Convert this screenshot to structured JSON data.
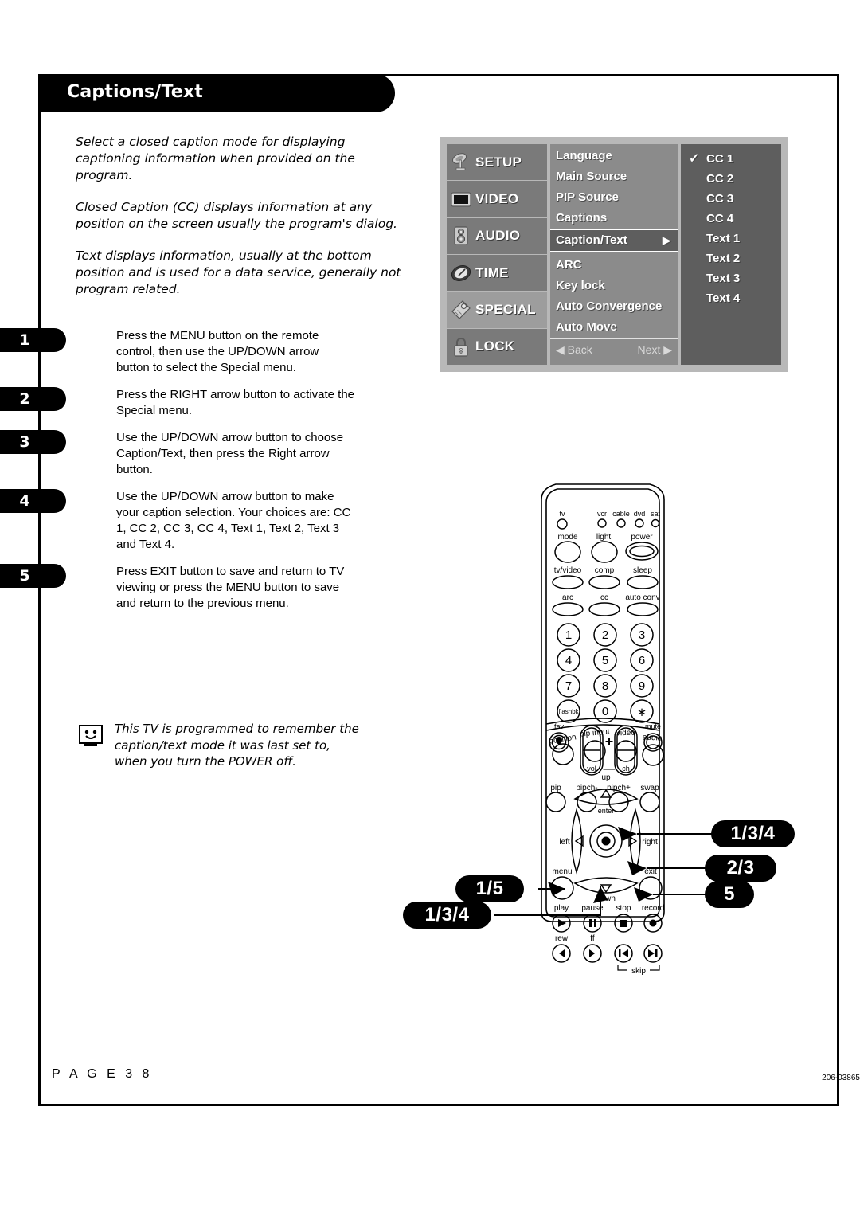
{
  "header": {
    "title": "Captions/Text"
  },
  "intro": {
    "paragraphs": [
      "Select a closed caption mode for displaying captioning information when provided on the program.",
      "Closed Caption (CC) displays information at any position on the screen usually the program's dialog.",
      "Text displays information, usually at the bottom position and is used for a data service, generally not program related."
    ]
  },
  "osd": {
    "categories": [
      {
        "label": "SETUP",
        "icon": "satellite-dish-icon",
        "active": false
      },
      {
        "label": "VIDEO",
        "icon": "tv-screen-icon",
        "active": false
      },
      {
        "label": "AUDIO",
        "icon": "speaker-icon",
        "active": false
      },
      {
        "label": "TIME",
        "icon": "clock-icon",
        "active": false
      },
      {
        "label": "SPECIAL",
        "icon": "tag-icon",
        "active": true
      },
      {
        "label": "LOCK",
        "icon": "padlock-icon",
        "active": false
      }
    ],
    "menu_top": [
      "Language",
      "Main Source",
      "PIP Source",
      "Captions"
    ],
    "menu_selected": {
      "label": "Caption/Text",
      "arrow": "▶"
    },
    "menu_bottom": [
      "ARC",
      "Key lock",
      "Auto Convergence",
      "Auto Move"
    ],
    "nav": {
      "back": "◀ Back",
      "next": "Next ▶"
    },
    "options": [
      {
        "label": "CC 1",
        "checked": true
      },
      {
        "label": "CC 2",
        "checked": false
      },
      {
        "label": "CC 3",
        "checked": false
      },
      {
        "label": "CC 4",
        "checked": false
      },
      {
        "label": "Text 1",
        "checked": false
      },
      {
        "label": "Text 2",
        "checked": false
      },
      {
        "label": "Text 3",
        "checked": false
      },
      {
        "label": "Text 4",
        "checked": false
      }
    ],
    "check_glyph": "✓"
  },
  "steps": [
    {
      "number": "1",
      "text": "Press the MENU button on the remote control, then use the UP/DOWN arrow button to select the Special menu."
    },
    {
      "number": "2",
      "text": "Press the RIGHT arrow button to activate the Special menu."
    },
    {
      "number": "3",
      "text": "Use the UP/DOWN arrow button to choose Caption/Text, then press the Right arrow button."
    },
    {
      "number": "4",
      "text": "Use the UP/DOWN arrow button to make your caption selection. Your choices are: CC 1, CC 2, CC 3, CC 4, Text 1, Text 2, Text 3 and Text 4."
    },
    {
      "number": "5",
      "text": "Press EXIT button to save and return to TV viewing or press the MENU button to save and return to the previous menu."
    }
  ],
  "note": {
    "icon": "tv-smiley-icon",
    "text": "This TV is programmed to remember the caption/text mode it was last set to, when you turn the POWER off."
  },
  "remote": {
    "mode_indicators": [
      "tv",
      "vcr",
      "cable",
      "dvd",
      "sat"
    ],
    "row_mode": [
      "mode",
      "light",
      "power"
    ],
    "row_tvvideo": [
      "tv/video",
      "comp",
      "sleep"
    ],
    "row_arc": [
      "arc",
      "cc",
      "auto conv"
    ],
    "keypad": [
      "1",
      "2",
      "3",
      "4",
      "5",
      "6",
      "7",
      "8",
      "9",
      "flashbk",
      "0",
      "∗"
    ],
    "fav_label": "fav",
    "mute_label": "mute",
    "vol_label": "vol",
    "ch_label": "ch",
    "plus_label": "+",
    "minus_label": "—",
    "row_pip": [
      "pip",
      "pipch-",
      "pipch+",
      "swap"
    ],
    "row_position": [
      "position",
      "pip input",
      "video",
      "audio"
    ],
    "dpad": {
      "up": "up",
      "down": "down",
      "left": "left",
      "right": "right",
      "enter": "enter"
    },
    "menu_label": "menu",
    "exit_label": "exit",
    "transport": [
      "play",
      "pause",
      "stop",
      "record"
    ],
    "transport2": [
      "rew",
      "ff"
    ],
    "skip_label": "skip"
  },
  "callouts": [
    {
      "id": "up-callout",
      "label": "1/3/4"
    },
    {
      "id": "right-callout",
      "label": "2/3"
    },
    {
      "id": "exit-callout",
      "label": "5"
    },
    {
      "id": "menu-callout",
      "label": "1/5"
    },
    {
      "id": "down-callout",
      "label": "1/3/4"
    }
  ],
  "footer": {
    "page": "P A G E   3 8",
    "code": "206-03865"
  }
}
